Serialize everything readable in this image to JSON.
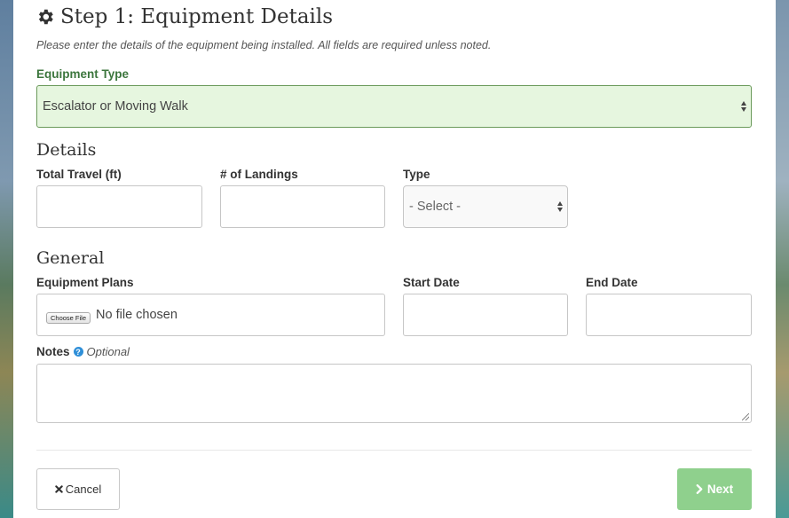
{
  "header": {
    "title": "Step 1: Equipment Details",
    "subtitle": "Please enter the details of the equipment being installed. All fields are required unless noted."
  },
  "equipment_type": {
    "label": "Equipment Type",
    "selected": "Escalator or Moving Walk"
  },
  "details": {
    "heading": "Details",
    "total_travel_label": "Total Travel (ft)",
    "total_travel_value": "",
    "landings_label": "# of Landings",
    "landings_value": "",
    "type_label": "Type",
    "type_selected": "- Select -"
  },
  "general": {
    "heading": "General",
    "plans_label": "Equipment Plans",
    "choose_file_label": "Choose File",
    "file_status": "No file chosen",
    "start_date_label": "Start Date",
    "start_date_value": "",
    "end_date_label": "End Date",
    "end_date_value": "",
    "notes_label": "Notes",
    "notes_optional": "Optional",
    "notes_value": ""
  },
  "actions": {
    "cancel_label": "Cancel",
    "next_label": "Next"
  },
  "icons": {
    "title": "gear-icon",
    "help": "question-circle-icon",
    "cancel": "times-icon",
    "next": "chevron-right-icon"
  },
  "colors": {
    "success_border": "#6b9a5b",
    "success_bg": "#e6f6df",
    "label_green": "#3c763d",
    "next_button": "#8fd08d",
    "help_icon": "#2f8fd8"
  }
}
